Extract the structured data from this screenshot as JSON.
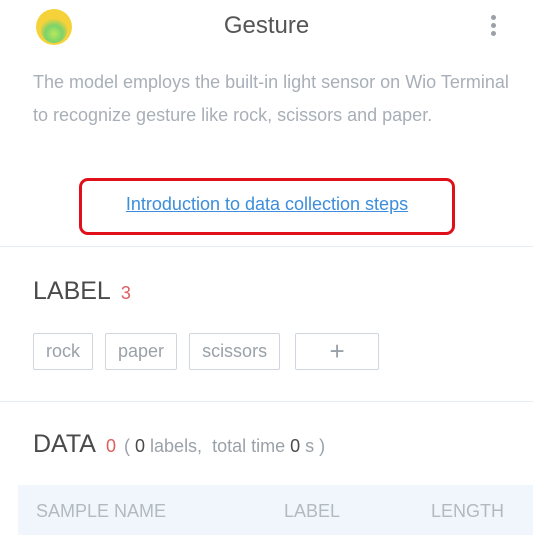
{
  "header": {
    "title": "Gesture",
    "logo_colors": [
      "#f6d23a",
      "#7bd36b"
    ],
    "menu_icon": "vertical-ellipsis-icon"
  },
  "description": "The model employs the built-in light sensor on Wio Terminal to recognize gesture like rock, scissors and paper.",
  "intro_link": "Introduction to data collection steps",
  "label_section": {
    "title": "LABEL",
    "count": "3",
    "tags": [
      "rock",
      "paper",
      "scissors"
    ],
    "add_icon": "plus-icon",
    "add_symbol": "+"
  },
  "data_section": {
    "title": "DATA",
    "count": "0",
    "open_paren": "(",
    "labels_count": "0",
    "labels_text": "labels,",
    "total_time_text": "total time",
    "total_time": "0",
    "unit_close": "s )"
  },
  "table": {
    "columns": [
      "SAMPLE NAME",
      "LABEL",
      "LENGTH"
    ]
  },
  "colors": {
    "accent_red": "#e05d5d",
    "link_blue": "#3c8ddb",
    "highlight_border": "#e0101a"
  }
}
